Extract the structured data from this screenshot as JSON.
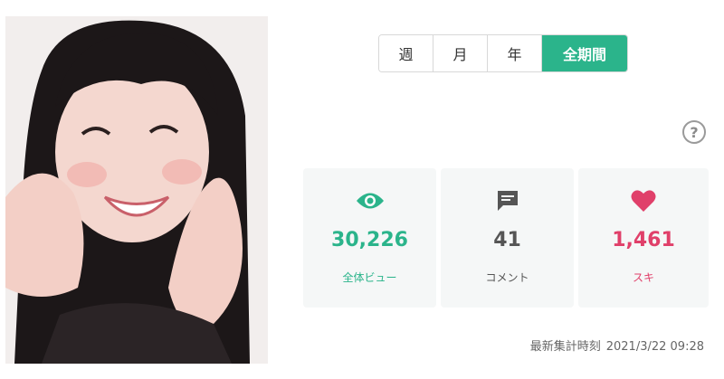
{
  "period_tabs": [
    {
      "label": "週",
      "active": false
    },
    {
      "label": "月",
      "active": false
    },
    {
      "label": "年",
      "active": false
    },
    {
      "label": "全期間",
      "active": true
    }
  ],
  "stats": {
    "views": {
      "icon": "eye-icon",
      "value": "30,226",
      "label": "全体ビュー",
      "color": "#2bb48b"
    },
    "comments": {
      "icon": "comment-icon",
      "value": "41",
      "label": "コメント",
      "color": "#555555"
    },
    "likes": {
      "icon": "heart-icon",
      "value": "1,461",
      "label": "スキ",
      "color": "#e0406a"
    }
  },
  "updated": {
    "label": "最新集計時刻",
    "timestamp": "2021/3/22 09:28"
  },
  "help": {
    "symbol": "?"
  }
}
